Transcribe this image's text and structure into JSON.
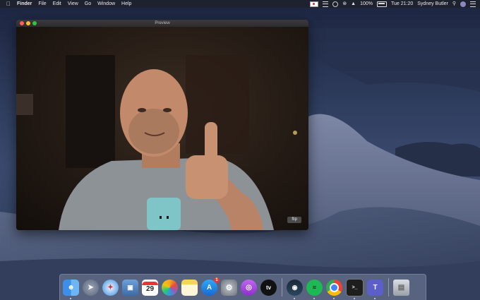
{
  "menubar": {
    "apple_icon": "apple-icon",
    "app_name": "Finder",
    "menus": [
      "File",
      "Edit",
      "View",
      "Go",
      "Window",
      "Help"
    ],
    "status": {
      "battery_percent": "100%",
      "clock": "Tue 21:20",
      "user_name": "Sydney Butler"
    }
  },
  "preview_window": {
    "title": "Preview",
    "flip_label": "flip"
  },
  "dock": {
    "items": [
      {
        "name": "finder-icon",
        "running": true
      },
      {
        "name": "launchpad-icon",
        "running": false
      },
      {
        "name": "safari-icon",
        "running": false
      },
      {
        "name": "preview-icon",
        "running": false
      },
      {
        "name": "calendar-icon",
        "running": false,
        "label": "29"
      },
      {
        "name": "photos-icon",
        "running": false
      },
      {
        "name": "notes-icon",
        "running": false
      },
      {
        "name": "app-store-icon",
        "running": false,
        "badge": "1"
      },
      {
        "name": "system-preferences-icon",
        "running": false
      },
      {
        "name": "podcasts-icon",
        "running": false
      },
      {
        "name": "apple-tv-icon",
        "running": false,
        "label": "tv"
      },
      {
        "name": "steam-icon",
        "running": true
      },
      {
        "name": "spotify-icon",
        "running": true
      },
      {
        "name": "chrome-icon",
        "running": true
      },
      {
        "name": "terminal-icon",
        "running": true
      },
      {
        "name": "teams-icon",
        "running": true
      },
      {
        "name": "trash-icon",
        "running": false
      }
    ]
  }
}
